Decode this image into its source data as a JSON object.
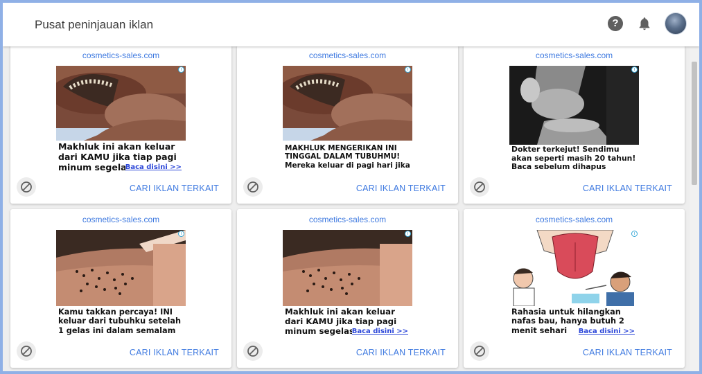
{
  "header": {
    "title": "Pusat peninjauan iklan",
    "help_icon": "help-icon",
    "notification_icon": "bell-icon",
    "avatar_icon": "account-avatar"
  },
  "colors": {
    "accent": "#3f7ae0",
    "frame": "#8fb0e6",
    "background": "#eeeeee"
  },
  "ads": [
    {
      "domain": "cosmetics-sales.com",
      "headline": "Makhluk ini akan keluar dari KAMU jika tiap pagi minum segelas..",
      "link": "Baca disini >>",
      "action": "CARI IKLAN TERKAIT",
      "image": "worm-in-skin-photo"
    },
    {
      "domain": "cosmetics-sales.com",
      "headline": "MAKHLUK MENGERIKAN INI TINGGAL DALAM TUBUHMU! Mereka keluar di pagi hari jika",
      "link": "",
      "action": "CARI IKLAN TERKAIT",
      "image": "worm-in-skin-photo"
    },
    {
      "domain": "cosmetics-sales.com",
      "headline": "Dokter terkejut! Sendimu akan seperti masih 20 tahun! Baca sebelum dihapus",
      "link": "",
      "action": "CARI IKLAN TERKAIT",
      "image": "knee-xray"
    },
    {
      "domain": "cosmetics-sales.com",
      "headline": "Kamu takkan percaya! INI keluar dari tubuhku setelah 1 gelas ini dalam semalam",
      "link": "",
      "action": "CARI IKLAN TERKAIT",
      "image": "skin-dots-photo"
    },
    {
      "domain": "cosmetics-sales.com",
      "headline": "Makhluk ini akan keluar dari KAMU jika tiap pagi minum segelas..",
      "link": "Baca disini >>",
      "action": "CARI IKLAN TERKAIT",
      "image": "skin-dots-photo"
    },
    {
      "domain": "cosmetics-sales.com",
      "headline": "Rahasia untuk hilangkan nafas bau, hanya butuh 2 menit sehari",
      "link": "Baca disini >>",
      "action": "CARI IKLAN TERKAIT",
      "image": "tongue-illustration"
    }
  ]
}
